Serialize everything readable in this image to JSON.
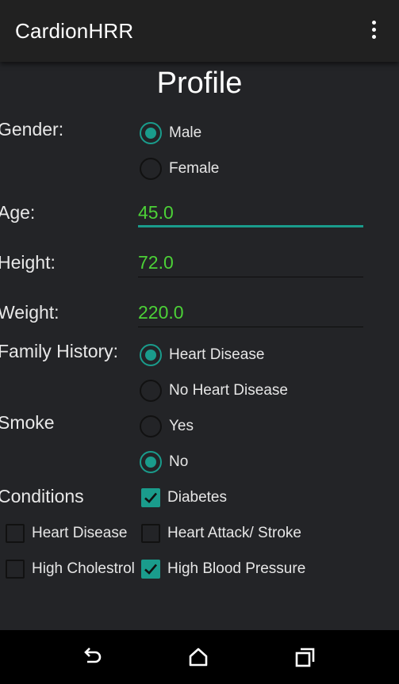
{
  "app": {
    "title": "CardionHRR"
  },
  "page": {
    "title": "Profile"
  },
  "gender": {
    "label": "Gender:",
    "options": [
      {
        "label": "Male",
        "selected": true
      },
      {
        "label": "Female",
        "selected": false
      }
    ]
  },
  "age": {
    "label": "Age:",
    "value": "45.0"
  },
  "height": {
    "label": "Height:",
    "value": "72.0"
  },
  "weight": {
    "label": "Weight:",
    "value": "220.0"
  },
  "family_history": {
    "label": "Family History:",
    "options": [
      {
        "label": "Heart Disease",
        "selected": true
      },
      {
        "label": "No Heart Disease",
        "selected": false
      }
    ]
  },
  "smoke": {
    "label": "Smoke",
    "options": [
      {
        "label": "Yes",
        "selected": false
      },
      {
        "label": "No",
        "selected": true
      }
    ]
  },
  "conditions": {
    "label": "Conditions",
    "items": [
      {
        "label": "Diabetes",
        "checked": true
      },
      {
        "label": "Heart Disease",
        "checked": false
      },
      {
        "label": "Heart Attack/ Stroke",
        "checked": false
      },
      {
        "label": "High Cholestrol",
        "checked": false
      },
      {
        "label": "High Blood Pressure",
        "checked": true
      }
    ]
  },
  "colors": {
    "accent": "#1a9c8c",
    "value_text": "#4cd137",
    "background": "#232427",
    "appbar": "#212121"
  },
  "icons": {
    "overflow": "more-vert-icon",
    "back": "back-icon",
    "home": "home-icon",
    "recents": "recents-icon"
  }
}
